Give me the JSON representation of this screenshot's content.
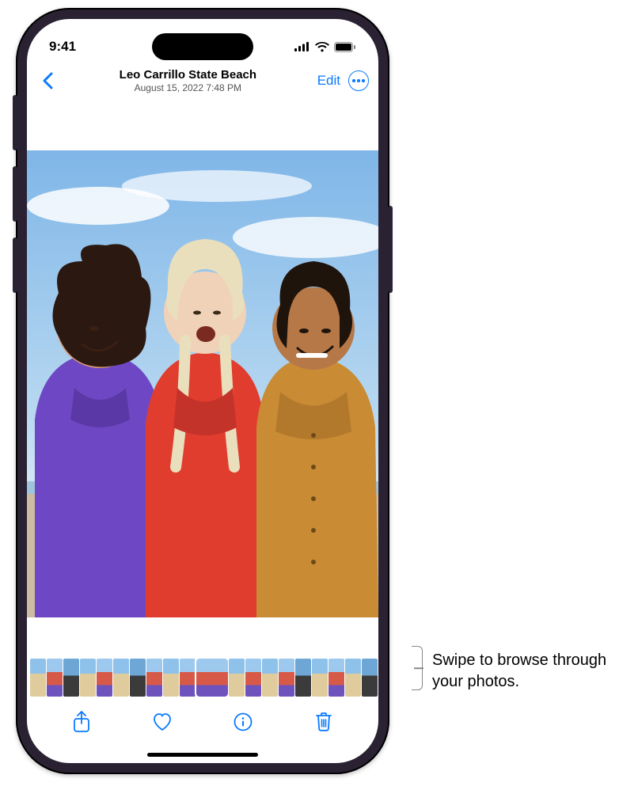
{
  "status_bar": {
    "time": "9:41",
    "icons": {
      "signal": "cellular-signal-icon",
      "wifi": "wifi-icon",
      "battery": "battery-icon"
    }
  },
  "header": {
    "title": "Leo Carrillo State Beach",
    "subtitle": "August 15, 2022  7:48 PM",
    "edit_label": "Edit"
  },
  "photo": {
    "description": "Three people laughing at the beach",
    "people": [
      {
        "shirt_color": "#6e48c4"
      },
      {
        "shirt_color": "#e13d2f"
      },
      {
        "shirt_color": "#c98b33"
      }
    ]
  },
  "thumbnails": {
    "count": 21,
    "selected_index": 10
  },
  "toolbar": {
    "share": "share-icon",
    "favorite": "heart-icon",
    "info": "info-icon",
    "delete": "trash-icon"
  },
  "callout": {
    "text": "Swipe to browse through your photos."
  },
  "colors": {
    "accent": "#0a7aff"
  }
}
